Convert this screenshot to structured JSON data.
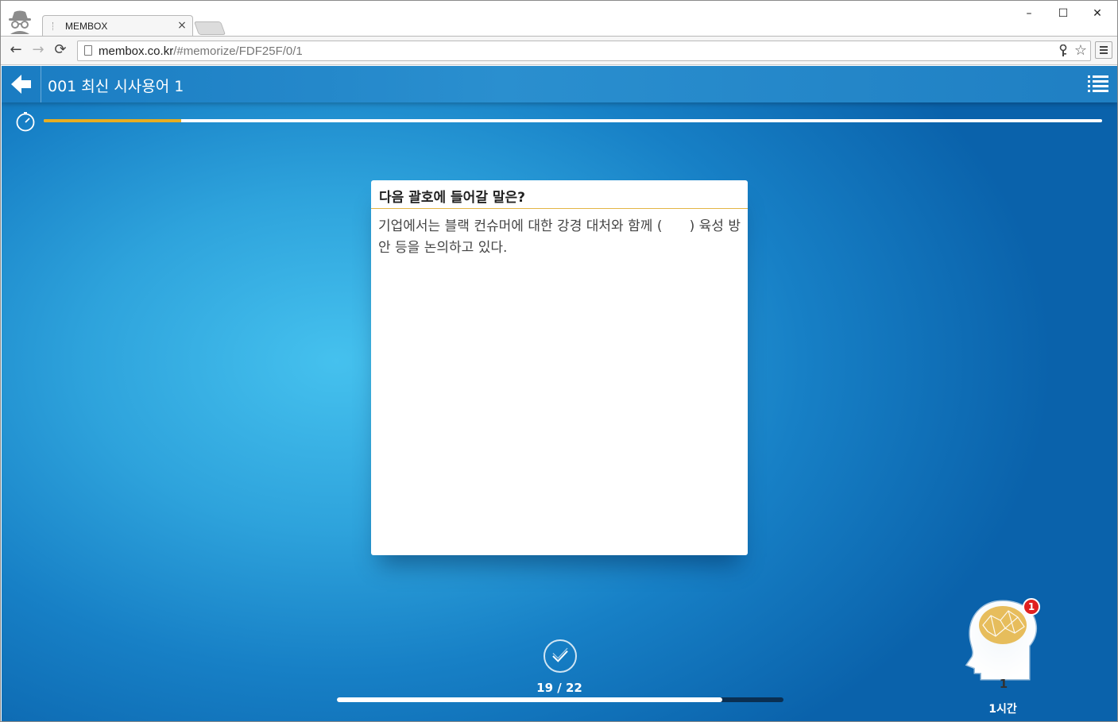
{
  "browser": {
    "tab_title": "MEMBOX",
    "tab_close": "×",
    "url_domain": "membox.co.kr",
    "url_path": "/#memorize/FDF25F/0/1",
    "window_controls": {
      "minimize": "–",
      "maximize": "☐",
      "close": "✕"
    },
    "nav": {
      "back": "←",
      "forward": "→",
      "reload": "⟳"
    },
    "star": "☆"
  },
  "app": {
    "header": {
      "title": "001 최신 시사용어 1"
    },
    "timer": {
      "progress": 0.13
    },
    "card": {
      "question": "다음 괄호에 들어갈 말은?",
      "text": "기업에서는 블랙 컨슈머에 대한 강경 대처와 함께 (　　) 육성 방안 등을 논의하고 있다."
    },
    "counter": {
      "text": "19 / 22",
      "current": 19,
      "total": 22
    },
    "brain": {
      "badge": "1",
      "count": "1",
      "label": "1시간"
    },
    "colors": {
      "accent": "#e6ad22",
      "badge": "#e02020",
      "header": "#2a8fcf"
    }
  }
}
